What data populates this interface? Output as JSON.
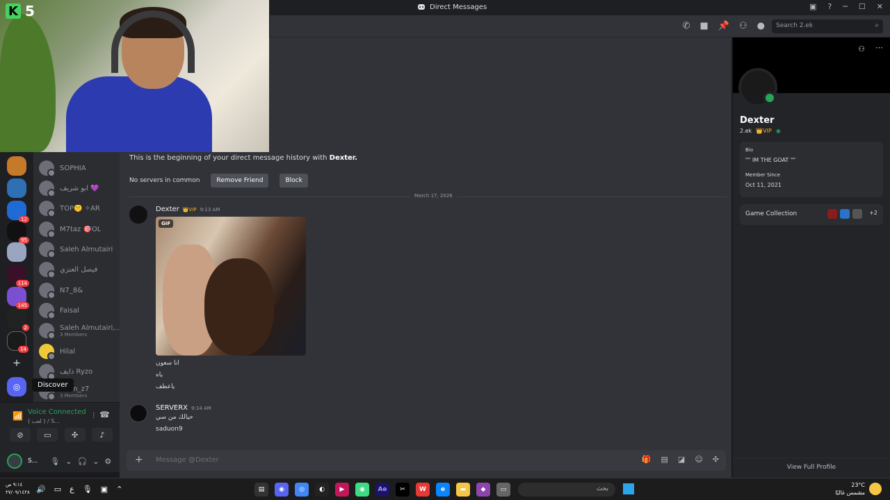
{
  "window": {
    "title": "Direct Messages"
  },
  "webcam": {
    "logo_letter": "K",
    "logo_number": "5"
  },
  "toolbar": {
    "search_placeholder": "Search 2.ek"
  },
  "servers": [
    {
      "badge": ""
    },
    {
      "badge": ""
    },
    {
      "badge": "12"
    },
    {
      "badge": "95"
    },
    {
      "badge": ""
    },
    {
      "badge": "114"
    },
    {
      "badge": "145"
    },
    {
      "badge": "2"
    },
    {
      "badge": "14"
    }
  ],
  "dms": [
    {
      "name": "SOPHIA",
      "sub": ""
    },
    {
      "name": "ابو شريف 💜",
      "sub": ""
    },
    {
      "name": "TOP🤫  ✧AR",
      "sub": ""
    },
    {
      "name": "M7taz  🎯OL",
      "sub": ""
    },
    {
      "name": "Saleh Almutairi",
      "sub": ""
    },
    {
      "name": "فيصل العنزي",
      "sub": ""
    },
    {
      "name": "N7_8&",
      "sub": ""
    },
    {
      "name": "Faisal",
      "sub": ""
    },
    {
      "name": "Saleh Almutairi,...",
      "sub": "3 Members"
    },
    {
      "name": "Hilal",
      "sub": ""
    },
    {
      "name": "ذايف Ryzo",
      "sub": ""
    },
    {
      "name": "..., m_z7",
      "sub": "3 Members"
    }
  ],
  "tooltip": "Discover",
  "voice": {
    "status": "Voice Connected",
    "sub": "( لعب ) / S...",
    "user_initial": "S..."
  },
  "chat": {
    "intro_prefix": "This is the beginning of your direct message history with ",
    "intro_name": "Dexter.",
    "no_servers": "No servers in common",
    "remove_friend": "Remove Friend",
    "block": "Block",
    "date_divider": "March 17, 2026",
    "messages": [
      {
        "author": "Dexter",
        "tag": "👑VIP",
        "time": "9:13 AM",
        "gif_label": "GIF",
        "lines": [
          "انا سعون",
          "ياه",
          "ياعطف"
        ]
      },
      {
        "author": "SERVERX",
        "tag": "",
        "time": "9:14 AM",
        "lines": [
          "حيالك من سي",
          "saduon9"
        ]
      }
    ],
    "composer_placeholder": "Message @Dexter"
  },
  "profile": {
    "name": "Dexter",
    "handle": "2.ek",
    "vip": "👑VIP",
    "bio_label": "Bio",
    "bio": "\"\" IM THE GOAT \"\"",
    "member_label": "Member Since",
    "member_since": "Oct 11, 2021",
    "game_collection": "Game Collection",
    "more_games": "+2",
    "view_full": "View Full Profile"
  },
  "taskbar": {
    "time": "٩:١٤ ص",
    "date": "٢٧/٠٩/١٤٢٨",
    "search": "بحث",
    "temp": "23°C",
    "weather": "مشمس غالبًا"
  },
  "colors": {
    "accent": "#5865f2",
    "online": "#23a55a",
    "vip": "#f0b232"
  }
}
